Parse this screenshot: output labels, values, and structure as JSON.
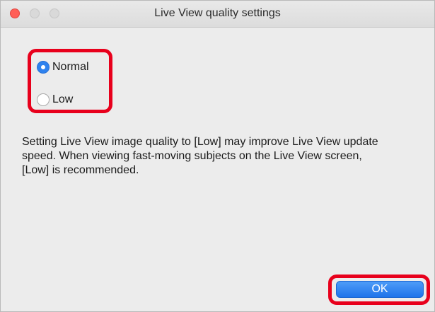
{
  "window": {
    "title": "Live View quality settings",
    "controls": [
      "close",
      "minimize",
      "zoom"
    ]
  },
  "quality": {
    "options": [
      {
        "label": "Normal",
        "selected": true
      },
      {
        "label": "Low",
        "selected": false
      }
    ]
  },
  "description": {
    "lines": [
      "Setting Live View image quality to [Low] may improve Live View update",
      "speed. When viewing fast-moving subjects on the Live View screen,",
      "[Low] is recommended."
    ]
  },
  "buttons": {
    "ok_label": "OK"
  },
  "colors": {
    "accent": "#2f82ee",
    "highlight": "#e8001c",
    "close": "#ff5f57"
  }
}
